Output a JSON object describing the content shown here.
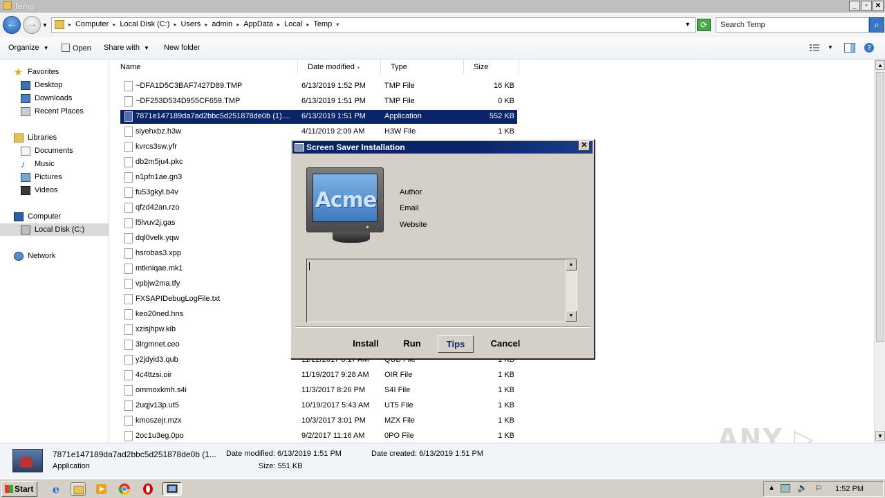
{
  "window": {
    "title": "Temp",
    "min": "_",
    "max": "▫",
    "close": "✕"
  },
  "address": {
    "crumbs": [
      "Computer",
      "Local Disk (C:)",
      "Users",
      "admin",
      "AppData",
      "Local",
      "Temp"
    ],
    "search_placeholder": "Search Temp"
  },
  "toolbar": {
    "organize": "Organize",
    "open": "Open",
    "share_with": "Share with",
    "new_folder": "New folder"
  },
  "nav": {
    "favorites": "Favorites",
    "desktop": "Desktop",
    "downloads": "Downloads",
    "recent_places": "Recent Places",
    "libraries": "Libraries",
    "documents": "Documents",
    "music": "Music",
    "pictures": "Pictures",
    "videos": "Videos",
    "computer": "Computer",
    "local_disk": "Local Disk (C:)",
    "network": "Network"
  },
  "columns": {
    "name": "Name",
    "date": "Date modified",
    "type": "Type",
    "size": "Size"
  },
  "files": [
    {
      "name": "~DFA1D5C3BAF7427D89.TMP",
      "date": "6/13/2019 1:52 PM",
      "type": "TMP File",
      "size": "16 KB"
    },
    {
      "name": "~DF253D534D955CF659.TMP",
      "date": "6/13/2019 1:51 PM",
      "type": "TMP File",
      "size": "0 KB"
    },
    {
      "name": "7871e147189da7ad2bbc5d251878de0b (1)....",
      "date": "6/13/2019 1:51 PM",
      "type": "Application",
      "size": "552 KB"
    },
    {
      "name": "siyehxbz.h3w",
      "date": "4/11/2019 2:09 AM",
      "type": "H3W File",
      "size": "1 KB"
    },
    {
      "name": "kvrcs3sw.yfr",
      "date": "",
      "type": "",
      "size": ""
    },
    {
      "name": "db2m5ju4.pkc",
      "date": "",
      "type": "",
      "size": ""
    },
    {
      "name": "n1pfn1ae.gn3",
      "date": "",
      "type": "",
      "size": ""
    },
    {
      "name": "fu53gkyl.b4v",
      "date": "",
      "type": "",
      "size": ""
    },
    {
      "name": "qfzd42an.rzo",
      "date": "",
      "type": "",
      "size": ""
    },
    {
      "name": "l5lvuv2j.gas",
      "date": "",
      "type": "",
      "size": ""
    },
    {
      "name": "dql0velk.yqw",
      "date": "",
      "type": "",
      "size": ""
    },
    {
      "name": "hsrobas3.xpp",
      "date": "",
      "type": "",
      "size": ""
    },
    {
      "name": "mtkniqae.mk1",
      "date": "",
      "type": "",
      "size": ""
    },
    {
      "name": "vpbjw2ma.tfy",
      "date": "",
      "type": "",
      "size": ""
    },
    {
      "name": "FXSAPIDebugLogFile.txt",
      "date": "",
      "type": "",
      "size": ""
    },
    {
      "name": "keo20ned.hns",
      "date": "",
      "type": "",
      "size": ""
    },
    {
      "name": "xzisjhpw.kib",
      "date": "",
      "type": "",
      "size": ""
    },
    {
      "name": "3lrgmnet.ceo",
      "date": "",
      "type": "",
      "size": ""
    },
    {
      "name": "y2jdyid3.qub",
      "date": "11/22/2017 8:17 AM",
      "type": "QUB File",
      "size": "1 KB"
    },
    {
      "name": "4c4ttzsi.oir",
      "date": "11/19/2017 9:28 AM",
      "type": "OIR File",
      "size": "1 KB"
    },
    {
      "name": "ommoxkmh.s4i",
      "date": "11/3/2017 8:26 PM",
      "type": "S4I File",
      "size": "1 KB"
    },
    {
      "name": "2uqjv13p.ut5",
      "date": "10/19/2017 5:43 AM",
      "type": "UT5 File",
      "size": "1 KB"
    },
    {
      "name": "kmoszejr.mzx",
      "date": "10/3/2017 3:01 PM",
      "type": "MZX File",
      "size": "1 KB"
    },
    {
      "name": "2oc1u3eg.0po",
      "date": "9/2/2017 11:16 AM",
      "type": "0PO File",
      "size": "1 KB"
    }
  ],
  "details": {
    "name": "7871e147189da7ad2bbc5d251878de0b (1...",
    "kind": "Application",
    "modified": "Date modified: 6/13/2019 1:51 PM",
    "size": "Size: 551 KB",
    "created": "Date created: 6/13/2019 1:51 PM"
  },
  "watermark": "ANY ▷ RUN",
  "dialog": {
    "title": "Screen Saver Installation",
    "logo": "Acme",
    "author": "Author",
    "email": "Email",
    "website": "Website",
    "buttons": {
      "install": "Install",
      "run": "Run",
      "tips": "Tips",
      "cancel": "Cancel"
    }
  },
  "taskbar": {
    "start": "Start",
    "clock": "1:52 PM"
  }
}
